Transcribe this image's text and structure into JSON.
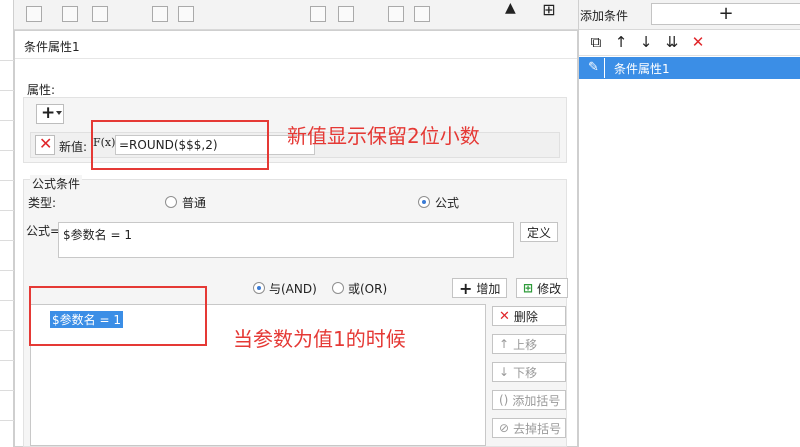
{
  "dialog": {
    "title": "条件属性1"
  },
  "attribute": {
    "section_label": "属性:",
    "new_value_label": "新值:",
    "formula_icon": "F(x)",
    "new_value": "=ROUND($$$,2)"
  },
  "formula_condition": {
    "section_label": "公式条件",
    "type_label": "类型:",
    "option_normal": "普通",
    "option_formula": "公式",
    "selected": "公式",
    "formula_label": "公式=",
    "formula_value": "$参数名 = 1",
    "define_button": "定义"
  },
  "logic": {
    "and_label": "与(AND)",
    "or_label": "或(OR)",
    "selected": "与(AND)",
    "add_button": "增加",
    "modify_button": "修改"
  },
  "conditions": {
    "items": [
      "$参数名 = 1"
    ]
  },
  "side_buttons": {
    "delete": "删除",
    "move_up": "上移",
    "move_down": "下移",
    "add_bracket": "添加括号",
    "remove_bracket": "去掉括号"
  },
  "annotations": {
    "note_value": "新值显示保留2位小数",
    "note_condition": "当参数为值1的时候"
  },
  "right_panel": {
    "add_condition_label": "添加条件",
    "add_symbol": "+",
    "items": [
      "条件属性1"
    ]
  },
  "colors": {
    "accent": "#3b8ee6",
    "annotation": "#e53935",
    "delete": "#e0262a"
  }
}
